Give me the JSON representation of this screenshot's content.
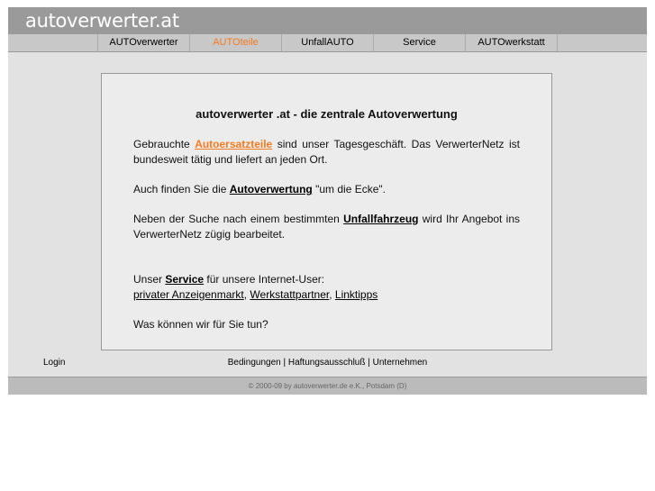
{
  "header": {
    "logo": "autoverwerter.at"
  },
  "nav": [
    {
      "label": "AUTOverwerter"
    },
    {
      "label": "AUTOteile",
      "active": true
    },
    {
      "label": "UnfallAUTO"
    },
    {
      "label": "Service"
    },
    {
      "label": "AUTOwerkstatt"
    }
  ],
  "content": {
    "title": "autoverwerter .at - die zentrale Autoverwertung",
    "p1": {
      "a": "Gebrauchte ",
      "link": "Autoersatzteile",
      "b": " sind unser Tagesgeschäft. Das VerwerterNetz ist bundesweit tätig und liefert an jeden Ort."
    },
    "p2": {
      "a": "Auch finden Sie die ",
      "link": "Autoverwertung",
      "b": " \"um die Ecke\"."
    },
    "p3": {
      "a": "Neben der Suche nach einem bestimmten ",
      "link": "Unfallfahrzeug",
      "b": " wird Ihr Angebot ins VerwerterNetz zügig bearbeitet."
    },
    "p4": {
      "a": "Unser ",
      "link": "Service",
      "b": " für unsere Internet-User:",
      "l1": "privater Anzeigenmarkt",
      "l2": "Werkstattpartner",
      "l3": "Linktipps",
      "sep": ", "
    },
    "p5": "Was können wir für Sie tun?"
  },
  "footer": {
    "login": "Login",
    "links": [
      "Bedingungen",
      "Haftungsausschluß",
      "Unternehmen"
    ],
    "sep": " | ",
    "copyright": "© 2000-09 by autoverwerter.de e.K., Potsdam (D)"
  },
  "colors": {
    "accent": "#f47a20"
  }
}
